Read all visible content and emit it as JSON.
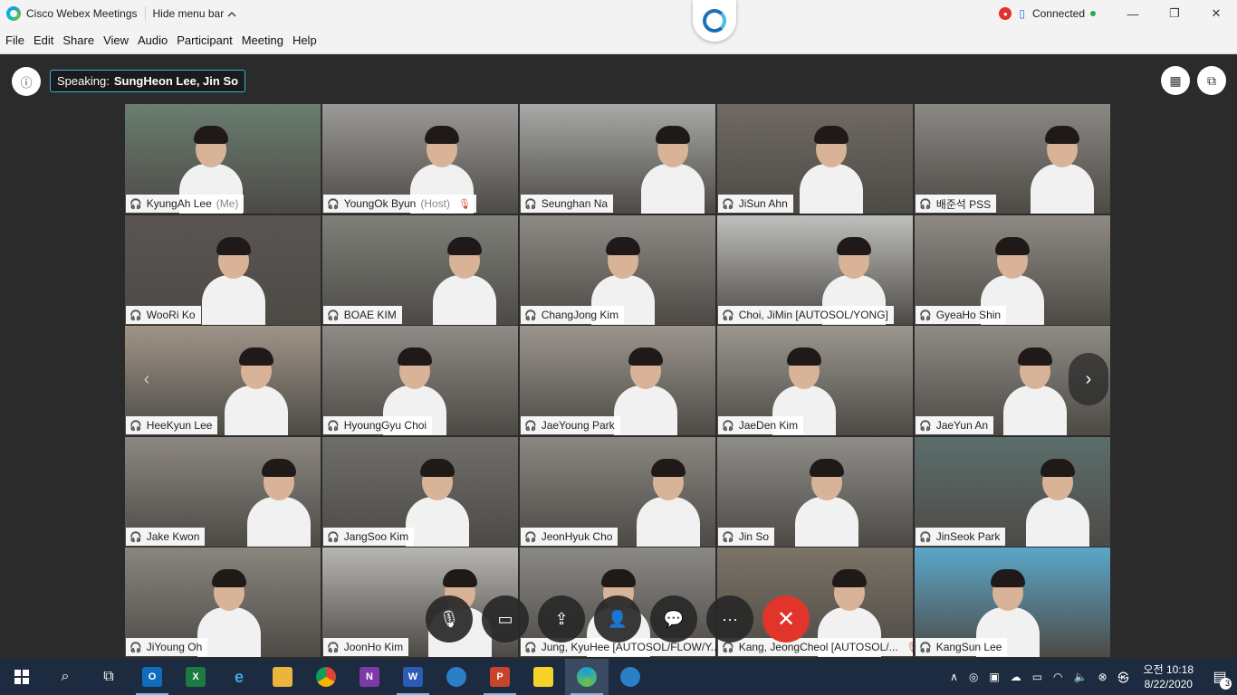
{
  "titlebar": {
    "app_title": "Cisco Webex Meetings",
    "hide_menu": "Hide menu bar",
    "hide_menu_icon": "chevron-up-icon",
    "status": "Connected",
    "minimize": "—",
    "maximize": "❐",
    "close": "✕"
  },
  "menubar": [
    "File",
    "Edit",
    "Share",
    "View",
    "Audio",
    "Participant",
    "Meeting",
    "Help"
  ],
  "meeting": {
    "speaking_label": "Speaking:",
    "speaking_names": "SungHeon Lee, Jin So",
    "info_icon": "ⓘ",
    "grid_icon": "▦",
    "popout_icon": "⧉",
    "prev_arrow": "‹",
    "next_arrow": "›"
  },
  "participants": [
    {
      "name": "KyungAh Lee",
      "suffix": " (Me)",
      "muted": false,
      "bg": "#6a7d70"
    },
    {
      "name": "YoungOk Byun",
      "suffix": " (Host)",
      "muted": true,
      "bg": "#9c9a98"
    },
    {
      "name": "Seunghan Na",
      "suffix": "",
      "muted": false,
      "bg": "#a8aaa8"
    },
    {
      "name": "JiSun Ahn",
      "suffix": "",
      "muted": false,
      "bg": "#6f6a62"
    },
    {
      "name": "배준석 PSS",
      "suffix": "",
      "muted": false,
      "bg": "#8b8984"
    },
    {
      "name": "WooRi Ko",
      "suffix": "",
      "muted": false,
      "bg": "#5a5552"
    },
    {
      "name": "BOAE KIM",
      "suffix": "",
      "muted": false,
      "bg": "#7e8079"
    },
    {
      "name": "ChangJong Kim",
      "suffix": "",
      "muted": false,
      "bg": "#8e8a86"
    },
    {
      "name": "Choi, JiMin [AUTOSOL/YONG]",
      "suffix": "",
      "muted": false,
      "bg": "#bfbfbd"
    },
    {
      "name": "GyeaHo Shin",
      "suffix": "",
      "muted": false,
      "bg": "#8f8a84"
    },
    {
      "name": "HeeKyun Lee",
      "suffix": "",
      "muted": false,
      "bg": "#a09488"
    },
    {
      "name": "HyoungGyu Choi",
      "suffix": "",
      "muted": false,
      "bg": "#8f8b86"
    },
    {
      "name": "JaeYoung Park",
      "suffix": "",
      "muted": false,
      "bg": "#9b958d"
    },
    {
      "name": "JaeDen Kim",
      "suffix": "",
      "muted": false,
      "bg": "#9c9890"
    },
    {
      "name": "JaeYun An",
      "suffix": "",
      "muted": false,
      "bg": "#8f8b85"
    },
    {
      "name": "Jake Kwon",
      "suffix": "",
      "muted": false,
      "bg": "#8c8780"
    },
    {
      "name": "JangSoo Kim",
      "suffix": "",
      "muted": false,
      "bg": "#6f6e6a"
    },
    {
      "name": "JeonHyuk Cho",
      "suffix": "",
      "muted": false,
      "bg": "#8a8781"
    },
    {
      "name": "Jin So",
      "suffix": "",
      "muted": false,
      "bg": "#8e8d88"
    },
    {
      "name": "JinSeok Park",
      "suffix": "",
      "muted": false,
      "bg": "#5b6e6c"
    },
    {
      "name": "JiYoung Oh",
      "suffix": "",
      "muted": false,
      "bg": "#8a857e"
    },
    {
      "name": "JoonHo Kim",
      "suffix": "",
      "muted": false,
      "bg": "#b8b6b2"
    },
    {
      "name": "Jung, KyuHee [AUTOSOL/FLOW/Y...",
      "suffix": "",
      "muted": false,
      "bg": "#8b8985"
    },
    {
      "name": "Kang, JeongCheol [AUTOSOL/...",
      "suffix": "",
      "muted": true,
      "bg": "#7c7366"
    },
    {
      "name": "KangSun Lee",
      "suffix": "",
      "muted": false,
      "bg": "#5aa7c8"
    }
  ],
  "controls": [
    {
      "name": "mute-button",
      "icon": "🎙"
    },
    {
      "name": "video-button",
      "icon": "▭"
    },
    {
      "name": "share-button",
      "icon": "⇪"
    },
    {
      "name": "participants-button",
      "icon": "👤"
    },
    {
      "name": "chat-button",
      "icon": "💬"
    },
    {
      "name": "more-button",
      "icon": "···"
    },
    {
      "name": "leave-button",
      "icon": "✕"
    }
  ],
  "taskbar": {
    "clock_time": "오전 10:18",
    "clock_date": "8/22/2020",
    "ime": "㉿",
    "notification_count": "3"
  }
}
